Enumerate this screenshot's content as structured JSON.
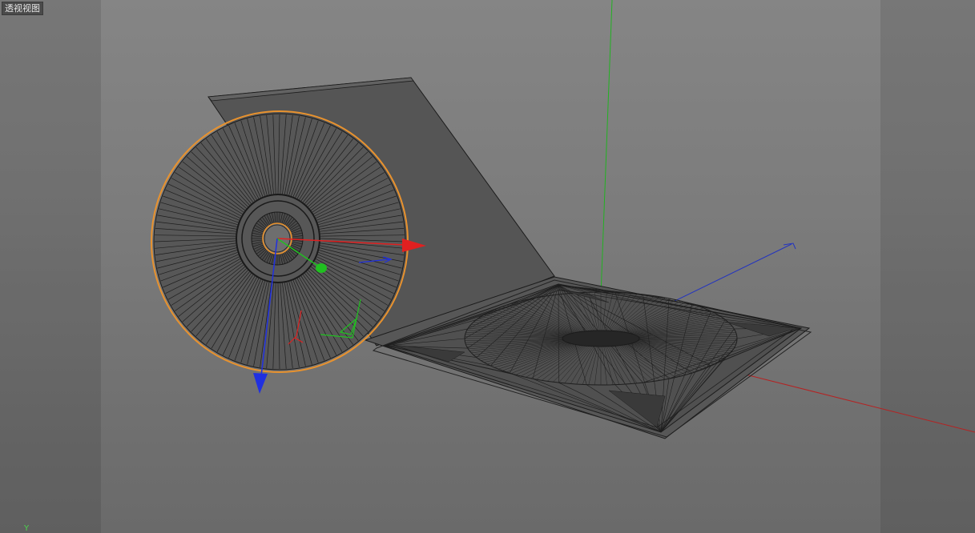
{
  "viewport": {
    "label": "透视视图",
    "axis_indicator": "Y"
  },
  "colors": {
    "background": "#7c7c7c",
    "selection_outline": "#e8922e",
    "wire": "#222222",
    "axis_x": "#e02020",
    "axis_y": "#20c020",
    "axis_z": "#2030e0",
    "world_x": "#b02020",
    "world_y": "#20b020",
    "world_z": "#2030c0"
  },
  "objects": [
    {
      "name": "cd-disc",
      "selected": true
    },
    {
      "name": "cd-case-lid",
      "selected": false
    },
    {
      "name": "cd-case-tray",
      "selected": false
    }
  ]
}
